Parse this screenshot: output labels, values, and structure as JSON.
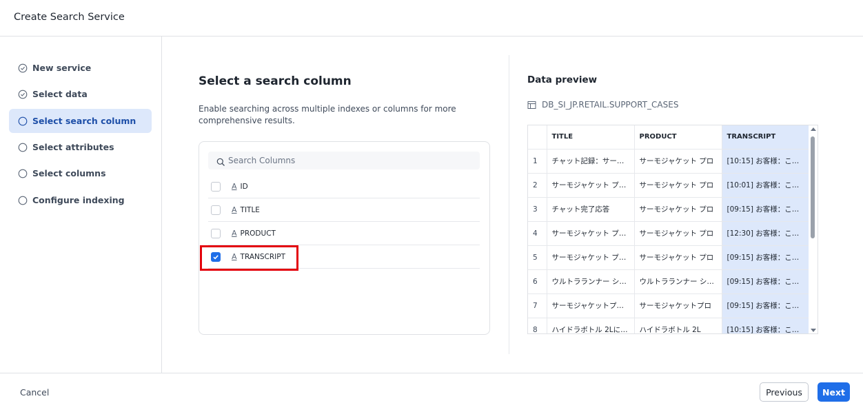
{
  "header": {
    "title": "Create Search Service"
  },
  "sidebar": {
    "steps": [
      {
        "label": "New service",
        "status": "done"
      },
      {
        "label": "Select data",
        "status": "done"
      },
      {
        "label": "Select search column",
        "status": "active"
      },
      {
        "label": "Select attributes",
        "status": "todo"
      },
      {
        "label": "Select columns",
        "status": "todo"
      },
      {
        "label": "Configure indexing",
        "status": "todo"
      }
    ]
  },
  "main": {
    "title": "Select a search column",
    "description": "Enable searching across multiple indexes or columns for more comprehensive results.",
    "search_placeholder": "Search Columns",
    "columns": [
      {
        "name": "ID",
        "type_icon": "text-type-icon",
        "checked": false
      },
      {
        "name": "TITLE",
        "type_icon": "text-type-icon",
        "checked": false
      },
      {
        "name": "PRODUCT",
        "type_icon": "text-type-icon",
        "checked": false
      },
      {
        "name": "TRANSCRIPT",
        "type_icon": "text-type-icon",
        "checked": true
      }
    ],
    "type_glyph": "A"
  },
  "preview": {
    "title": "Data preview",
    "source": "DB_SI_JP.RETAIL.SUPPORT_CASES",
    "headers": [
      "",
      "TITLE",
      "PRODUCT",
      "TRANSCRIPT"
    ],
    "rows": [
      [
        "1",
        "チャット記録：サーモ…",
        "サーモジャケット プロ",
        "[10:15] お客様：こん…"
      ],
      [
        "2",
        "サーモジャケット プロ…",
        "サーモジャケット プロ",
        "[10:01] お客様：こん…"
      ],
      [
        "3",
        "チャット完了応答",
        "サーモジャケット プロ",
        "[09:15] お客様：こん…"
      ],
      [
        "4",
        "サーモジャケット プロ…",
        "サーモジャケット プロ",
        "[12:30] お客様：こん…"
      ],
      [
        "5",
        "サーモジャケット プロ…",
        "サーモジャケット プロ",
        "[09:15] お客様：こん…"
      ],
      [
        "6",
        "ウルトラランナー シュ…",
        "ウルトラランナー シュ…",
        "[09:15] お客様：こん…"
      ],
      [
        "7",
        "サーモジャケットプロ…",
        "サーモジャケットプロ",
        "[09:15] お客様：こん…"
      ],
      [
        "8",
        "ハイドラボトル 2Lに…",
        "ハイドラボトル 2L",
        "[10:15] お客様：こん…"
      ]
    ],
    "highlighted_column": "TRANSCRIPT"
  },
  "footer": {
    "cancel": "Cancel",
    "previous": "Previous",
    "next": "Next"
  },
  "colors": {
    "accent": "#1f6ee8",
    "active_bg": "#dde8fb",
    "highlight_box": "#e3000b"
  }
}
